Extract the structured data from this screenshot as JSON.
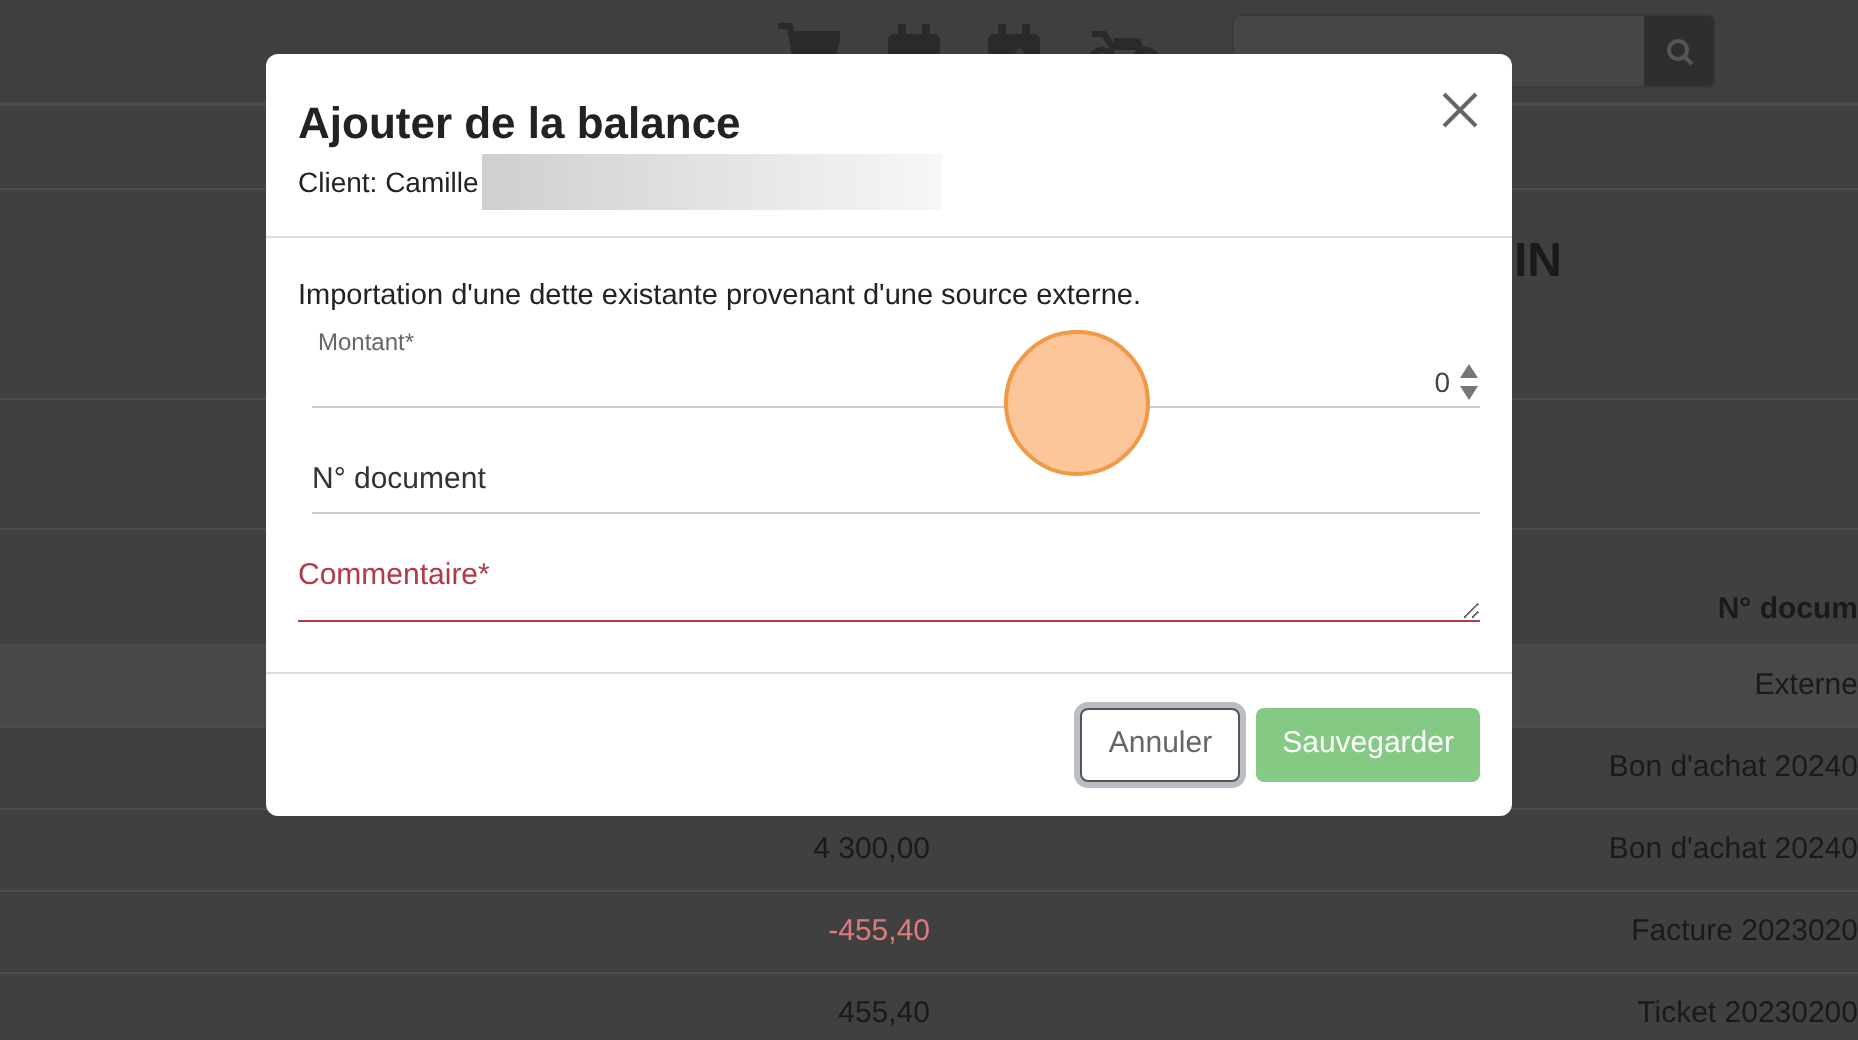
{
  "page": {
    "title_fragment": "IN",
    "table": {
      "document_header": "N° docum",
      "rows": [
        {
          "document": "Externe"
        },
        {
          "document": "Bon d'achat 20240"
        },
        {
          "amount": "4 300,00",
          "negative": false,
          "document": "Bon d'achat 20240"
        },
        {
          "amount": "-455,40",
          "negative": true,
          "document": "Facture 2023020"
        },
        {
          "amount": "455,40",
          "negative": false,
          "document": "Ticket 20230200"
        }
      ]
    }
  },
  "modal": {
    "title": "Ajouter de la balance",
    "client": "Client: Camille",
    "description": "Importation d'une dette existante provenant d'une source externe.",
    "fields": [
      {
        "kind": "number",
        "label": "Montant*",
        "value": "0",
        "invalid": false
      },
      {
        "kind": "text",
        "placeholder": "N° document",
        "invalid": false
      },
      {
        "kind": "textarea",
        "placeholder": "Commentaire*",
        "invalid": true
      }
    ],
    "buttons": [
      {
        "label": "Annuler",
        "kind": "secondary",
        "focused": true,
        "disabled": false
      },
      {
        "label": "Sauvegarder",
        "kind": "primary",
        "focused": false,
        "disabled": true
      }
    ]
  }
}
